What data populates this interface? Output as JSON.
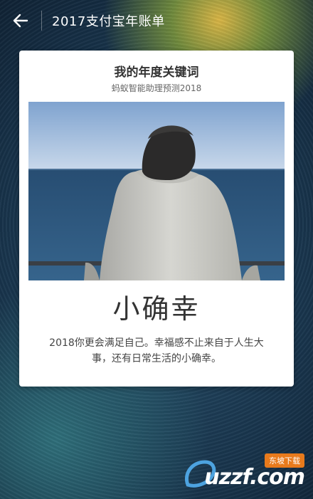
{
  "header": {
    "title": "2017支付宝年账单"
  },
  "card": {
    "title": "我的年度关键词",
    "subtitle": "蚂蚁智能助理预测2018",
    "keyword": "小确幸",
    "description": "2018你更会满足自己。幸福感不止来自于人生大事，还有日常生活的小确幸。"
  },
  "watermark": {
    "tag": "东坡下载",
    "text": "uzzf.com"
  },
  "colors": {
    "card_bg": "#ffffff",
    "page_bg": "#14263a",
    "watermark_tag": "#e87a1c"
  }
}
